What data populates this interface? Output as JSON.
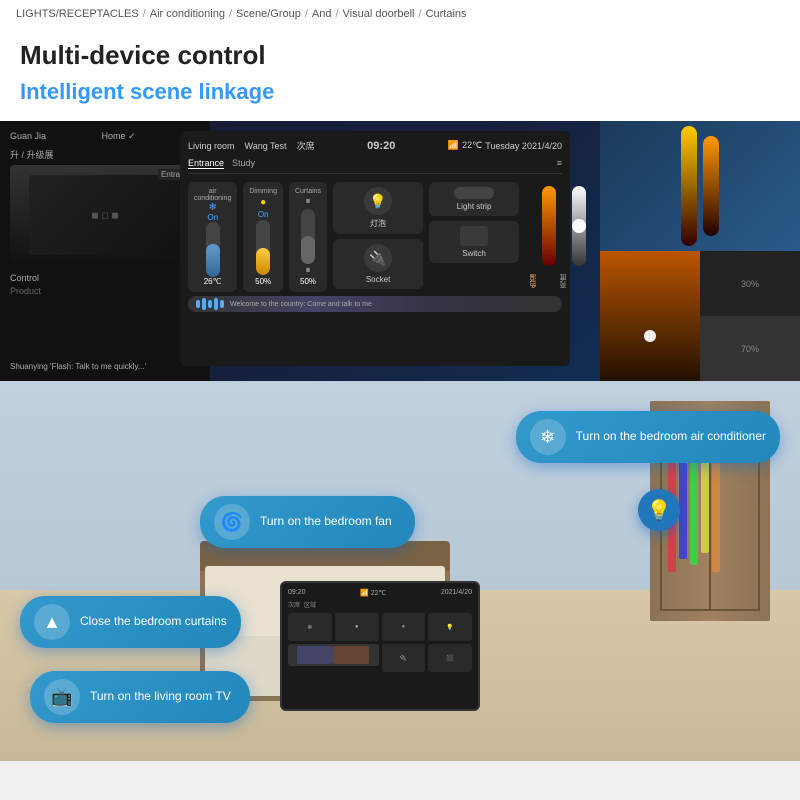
{
  "breadcrumb": {
    "items": [
      "LIGHTS/RECEPTACLES",
      "Air conditioning",
      "Scene/Group",
      "And",
      "Visual doorbell",
      "Curtains"
    ]
  },
  "header": {
    "main_title": "Multi-device control",
    "sub_title": "Intelligent scene linkage"
  },
  "smart_panel": {
    "time": "09:20",
    "date": "Tuesday 2021/4/20",
    "temp": "22℃",
    "room": "Living room",
    "user": "Wang Test",
    "status": "次席",
    "tabs": [
      "Entrance",
      "Study"
    ],
    "controls": [
      {
        "label": "air conditioning",
        "status": "On",
        "value": "26℃"
      },
      {
        "label": "Dimming",
        "status": "On",
        "value": "50%"
      },
      {
        "label": "Curtains",
        "status": "pause",
        "value": "50%"
      }
    ],
    "devices": [
      "灯泡",
      "Socket",
      "Light strip",
      "Switch"
    ],
    "sliders": [
      "30%",
      "70%"
    ],
    "voice_text": "Welcome to the country: Come and talk to me"
  },
  "commands": {
    "ac": {
      "icon": "❄",
      "text": "Turn on the bedroom air conditioner"
    },
    "fan": {
      "icon": "⊕",
      "text": "Turn on the bedroom fan"
    },
    "curtains": {
      "icon": "▲",
      "text": "Close the bedroom curtains"
    },
    "tv": {
      "icon": "📺",
      "text": "Turn on the living room TV"
    }
  },
  "icons": {
    "bulb": "💡",
    "ac": "❄️",
    "fan": "🌀",
    "curtain": "▼",
    "tv": "📺"
  }
}
